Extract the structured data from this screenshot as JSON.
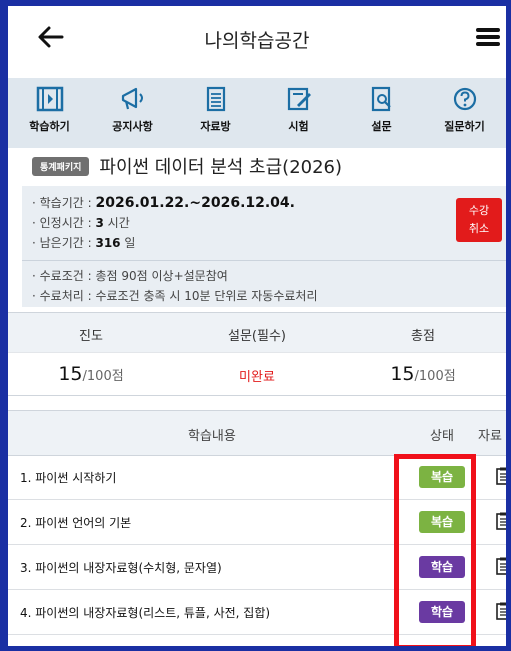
{
  "header": {
    "title": "나의학습공간"
  },
  "nav": [
    {
      "label": "학습하기",
      "icon": "film-icon"
    },
    {
      "label": "공지사항",
      "icon": "megaphone-icon"
    },
    {
      "label": "자료방",
      "icon": "document-icon"
    },
    {
      "label": "시험",
      "icon": "exam-pencil-icon"
    },
    {
      "label": "설문",
      "icon": "survey-search-icon"
    },
    {
      "label": "질문하기",
      "icon": "question-icon"
    }
  ],
  "course": {
    "badge": "통계패키지",
    "name": "파이썬 데이터 분석 초급(2026)"
  },
  "info": {
    "period_label": "학습기간 : ",
    "period_value": "2026.01.22.~2026.12.04.",
    "credit_label": "인정시간 : ",
    "credit_value": "3",
    "credit_unit": " 시간",
    "remain_label": "남은기간 : ",
    "remain_value": "316",
    "remain_unit": " 일",
    "cancel_line1": "수강",
    "cancel_line2": "취소"
  },
  "conditions": {
    "line1": "수료조건 : 총점 90점 이상+설문참여",
    "line2": "수료처리 : 수료조건 충족 시 10분 단위로 자동수료처리"
  },
  "stats": {
    "headers": [
      "진도",
      "설문(필수)",
      "총점"
    ],
    "progress_value": "15",
    "progress_unit": "/100점",
    "survey_value": "미완료",
    "total_value": "15",
    "total_unit": "/100점"
  },
  "list": {
    "headers": [
      "학습내용",
      "상태",
      "자료"
    ],
    "items": [
      {
        "title": "1. 파이썬 시작하기",
        "status": "복습"
      },
      {
        "title": "2. 파이썬 언어의 기본",
        "status": "복습"
      },
      {
        "title": "3. 파이썬의 내장자료형(수치형, 문자열)",
        "status": "학습"
      },
      {
        "title": "4. 파이썬의 내장자료형(리스트, 튜플, 사전, 집합)",
        "status": "학습"
      }
    ]
  },
  "colors": {
    "accent": "#1a2fa3",
    "review": "#7cb342",
    "study": "#6a3aa2",
    "alert": "#e21b1b"
  }
}
